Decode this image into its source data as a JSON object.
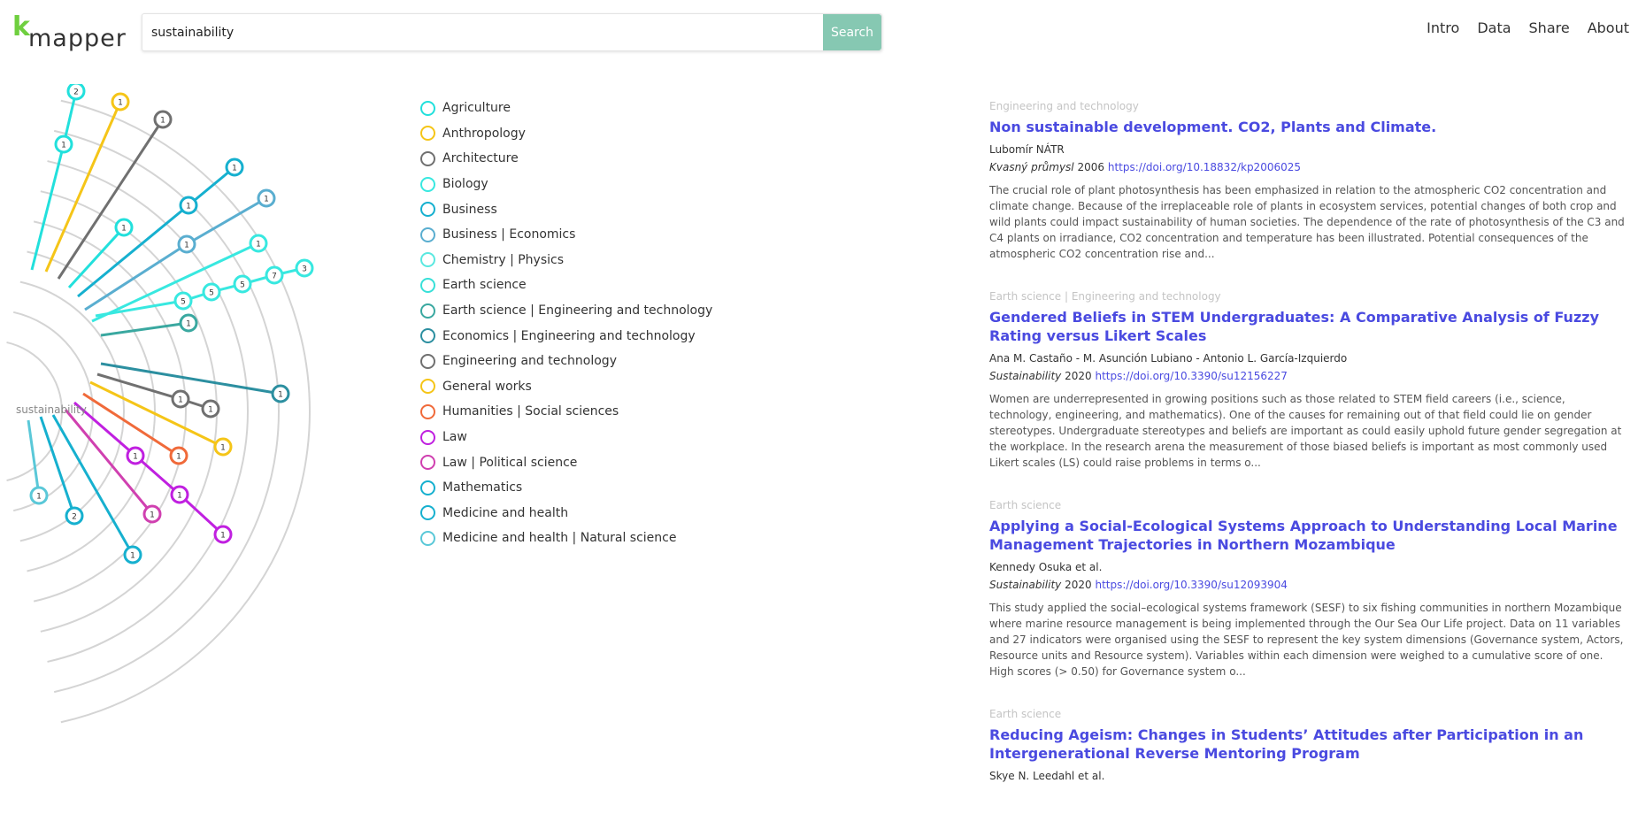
{
  "header": {
    "logo_k": "k",
    "logo_word": "mapper",
    "search_value": "sustainability",
    "search_button": "Search",
    "nav": [
      "Intro",
      "Data",
      "Share",
      "About"
    ]
  },
  "radial": {
    "center_label": "sustainability",
    "arcs_count": 9,
    "branches": [
      {
        "color": "#22e0dc",
        "dots": [
          {
            "label": "1"
          },
          {
            "label": "2"
          }
        ]
      },
      {
        "color": "#f5c518",
        "dots": [
          {
            "label": "1"
          }
        ]
      },
      {
        "color": "#707070",
        "dots": [
          {
            "label": "1"
          }
        ]
      },
      {
        "color": "#22e0dc",
        "dots": [
          {
            "label": "1"
          }
        ]
      },
      {
        "color": "#16b0cf",
        "dots": [
          {
            "label": "1"
          },
          {
            "label": "1"
          }
        ]
      },
      {
        "color": "#5aaed0",
        "dots": [
          {
            "label": "1"
          },
          {
            "label": "1"
          }
        ]
      },
      {
        "color": "#38e8e0",
        "dots": [
          {
            "label": "1"
          }
        ]
      },
      {
        "color": "#38e8e0",
        "dots": [
          {
            "label": "5"
          },
          {
            "label": "5"
          },
          {
            "label": "5"
          },
          {
            "label": "7"
          },
          {
            "label": "3"
          }
        ]
      },
      {
        "color": "#3aa8a0",
        "dots": [
          {
            "label": "1"
          }
        ]
      },
      {
        "color": "#2c8fa0",
        "dots": [
          {
            "label": "1"
          }
        ]
      },
      {
        "color": "#707070",
        "dots": [
          {
            "label": "1"
          },
          {
            "label": "1"
          }
        ]
      },
      {
        "color": "#f5c518",
        "dots": [
          {
            "label": "1"
          }
        ]
      },
      {
        "color": "#f06a3a",
        "dots": [
          {
            "label": "1"
          }
        ]
      },
      {
        "color": "#c020e0",
        "dots": [
          {
            "label": "1"
          },
          {
            "label": "1"
          },
          {
            "label": "1"
          }
        ]
      },
      {
        "color": "#d040b0",
        "dots": [
          {
            "label": "1"
          }
        ]
      },
      {
        "color": "#16b0cf",
        "dots": [
          {
            "label": "1"
          }
        ]
      },
      {
        "color": "#16b0cf",
        "dots": [
          {
            "label": "2"
          }
        ]
      },
      {
        "color": "#5ac8d8",
        "dots": [
          {
            "label": "1"
          }
        ]
      }
    ]
  },
  "legend": [
    {
      "label": "Agriculture",
      "color": "#22e0dc"
    },
    {
      "label": "Anthropology",
      "color": "#f5c518"
    },
    {
      "label": "Architecture",
      "color": "#707070"
    },
    {
      "label": "Biology",
      "color": "#38e8e0"
    },
    {
      "label": "Business",
      "color": "#16b0cf"
    },
    {
      "label": "Business | Economics",
      "color": "#5aaed0"
    },
    {
      "label": "Chemistry | Physics",
      "color": "#5ae8e0"
    },
    {
      "label": "Earth science",
      "color": "#38e0d8"
    },
    {
      "label": "Earth science | Engineering and technology",
      "color": "#3aa8a0"
    },
    {
      "label": "Economics | Engineering and technology",
      "color": "#2c8fa0"
    },
    {
      "label": "Engineering and technology",
      "color": "#707070"
    },
    {
      "label": "General works",
      "color": "#f5c518"
    },
    {
      "label": "Humanities | Social sciences",
      "color": "#f06a3a"
    },
    {
      "label": "Law",
      "color": "#c020e0"
    },
    {
      "label": "Law | Political science",
      "color": "#d040b0"
    },
    {
      "label": "Mathematics",
      "color": "#16b0cf"
    },
    {
      "label": "Medicine and health",
      "color": "#16b0cf"
    },
    {
      "label": "Medicine and health | Natural science",
      "color": "#5ac8d8"
    }
  ],
  "results": [
    {
      "category": "Engineering and technology",
      "title": "Non sustainable development. CO2, Plants and Climate.",
      "authors": "Lubomír NÁTR",
      "journal": "Kvasný průmysl",
      "year": "2006",
      "doi": "https://doi.org/10.18832/kp2006025",
      "abstract": "The crucial role of plant photosynthesis has been emphasized in relation to the atmospheric CO2 concentration and climate change. Because of the irreplaceable role of plants in ecosystem services, potential changes of both crop and wild plants could impact sustainability of human societies. The dependence of the rate of photosynthesis of the C3 and C4 plants on irradiance, CO2 concentration and temperature has been illustrated. Potential consequences of the atmospheric CO2 concentration rise and..."
    },
    {
      "category": "Earth science | Engineering and technology",
      "title": "Gendered Beliefs in STEM Undergraduates: A Comparative Analysis of Fuzzy Rating versus Likert Scales",
      "authors": "Ana M. Castaño - M. Asunción Lubiano - Antonio L. García-Izquierdo",
      "journal": "Sustainability",
      "year": "2020",
      "doi": "https://doi.org/10.3390/su12156227",
      "abstract": "Women are underrepresented in growing positions such as those related to STEM field careers (i.e., science, technology, engineering, and mathematics). One of the causes for remaining out of that field could lie on gender stereotypes. Undergraduate stereotypes and beliefs are important as could easily uphold future gender segregation at the workplace. In the research arena the measurement of those biased beliefs is important as most commonly used Likert scales (LS) could raise problems in terms o..."
    },
    {
      "category": "Earth science",
      "title": "Applying a Social-Ecological Systems Approach to Understanding Local Marine Management Trajectories in Northern Mozambique",
      "authors": "Kennedy Osuka et al.",
      "journal": "Sustainability",
      "year": "2020",
      "doi": "https://doi.org/10.3390/su12093904",
      "abstract": "This study applied the social–ecological systems framework (SESF) to six fishing communities in northern Mozambique where marine resource management is being implemented through the Our Sea Our Life project. Data on 11 variables and 27 indicators were organised using the SESF to represent the key system dimensions (Governance system, Actors, Resource units and Resource system). Variables within each dimension were weighed to a cumulative score of one. High scores (> 0.50) for Governance system o..."
    },
    {
      "category": "Earth science",
      "title": "Reducing Ageism: Changes in Students’ Attitudes after Participation in an Intergenerational Reverse Mentoring Program",
      "authors": "Skye N. Leedahl et al.",
      "journal": "",
      "year": "",
      "doi": "",
      "abstract": ""
    }
  ]
}
